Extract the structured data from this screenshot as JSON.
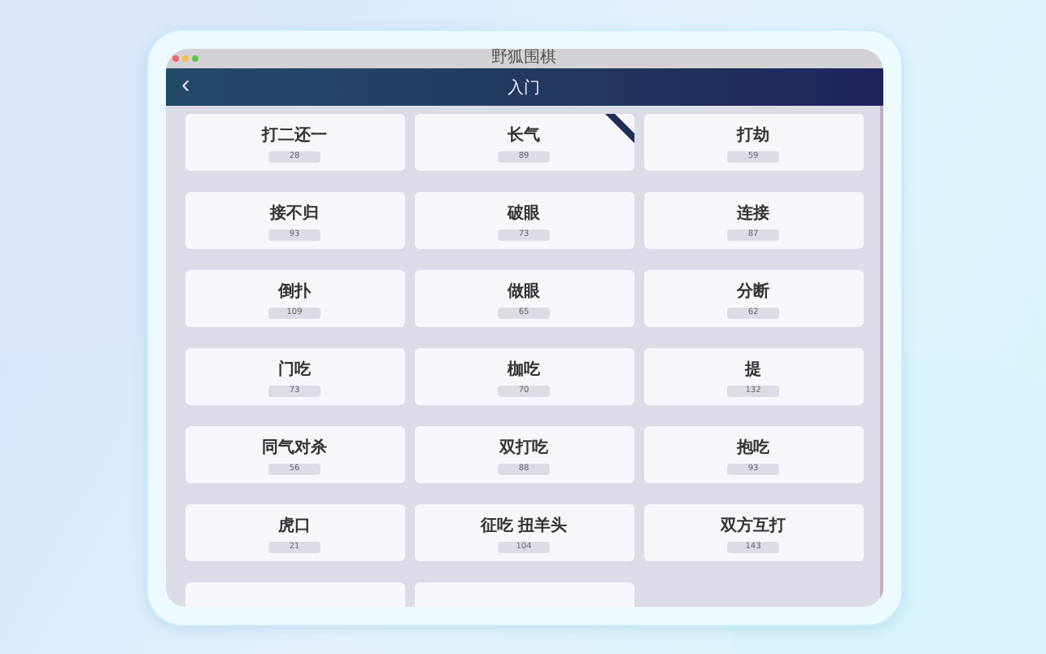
{
  "window": {
    "title": "野狐围棋"
  },
  "nav": {
    "back": "‹",
    "title": "入门"
  },
  "cards": [
    {
      "name": "打二还一",
      "count": "28",
      "ribbon": false
    },
    {
      "name": "长气",
      "count": "89",
      "ribbon": true
    },
    {
      "name": "打劫",
      "count": "59",
      "ribbon": false
    },
    {
      "name": "接不归",
      "count": "93",
      "ribbon": false
    },
    {
      "name": "破眼",
      "count": "73",
      "ribbon": false
    },
    {
      "name": "连接",
      "count": "87",
      "ribbon": false
    },
    {
      "name": "倒扑",
      "count": "109",
      "ribbon": false
    },
    {
      "name": "做眼",
      "count": "65",
      "ribbon": false
    },
    {
      "name": "分断",
      "count": "62",
      "ribbon": false
    },
    {
      "name": "门吃",
      "count": "73",
      "ribbon": false
    },
    {
      "name": "枷吃",
      "count": "70",
      "ribbon": false
    },
    {
      "name": "提",
      "count": "132",
      "ribbon": false
    },
    {
      "name": "同气对杀",
      "count": "56",
      "ribbon": false
    },
    {
      "name": "双打吃",
      "count": "88",
      "ribbon": false
    },
    {
      "name": "抱吃",
      "count": "93",
      "ribbon": false
    },
    {
      "name": "虎口",
      "count": "21",
      "ribbon": false
    },
    {
      "name": "征吃 扭羊头",
      "count": "104",
      "ribbon": false
    },
    {
      "name": "双方互打",
      "count": "143",
      "ribbon": false
    }
  ],
  "partial_cards": [
    {
      "kind": "cut-off"
    },
    {
      "kind": "cut-off"
    }
  ]
}
